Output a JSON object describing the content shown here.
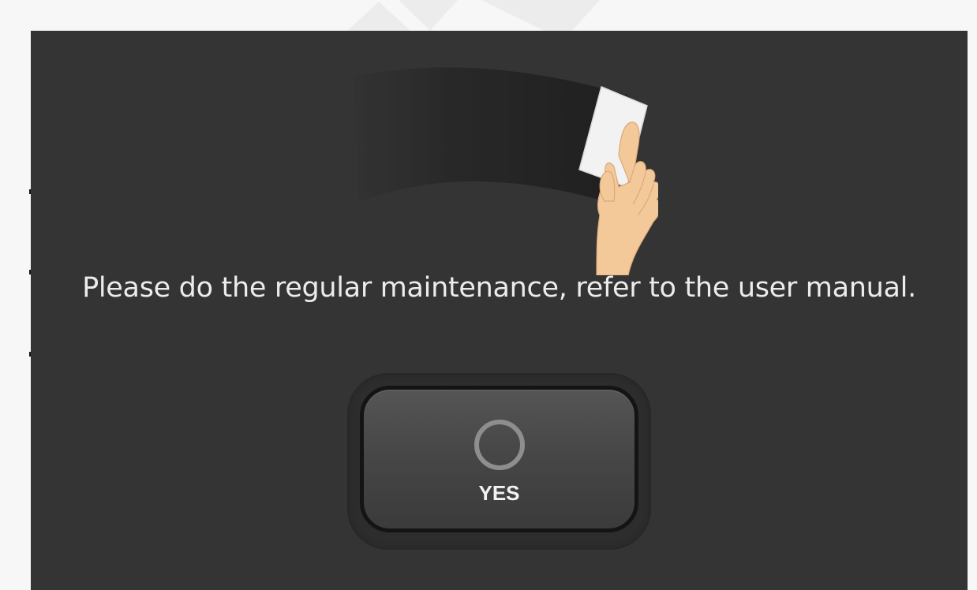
{
  "dialog": {
    "illustration_icon": "wipe-screen-with-cloth-icon",
    "message": "Please do the regular maintenance, refer to the user manual.",
    "yes_button": {
      "icon": "circle-ok-icon",
      "label": "YES"
    }
  },
  "colors": {
    "page_background": "#f7f7f7",
    "panel_background": "#343434",
    "message_text": "#ececec",
    "button_face": "#4a4a4a",
    "button_border": "#141414",
    "hand_skin": "#f4c99a",
    "cloth": "#f2f2f2"
  }
}
